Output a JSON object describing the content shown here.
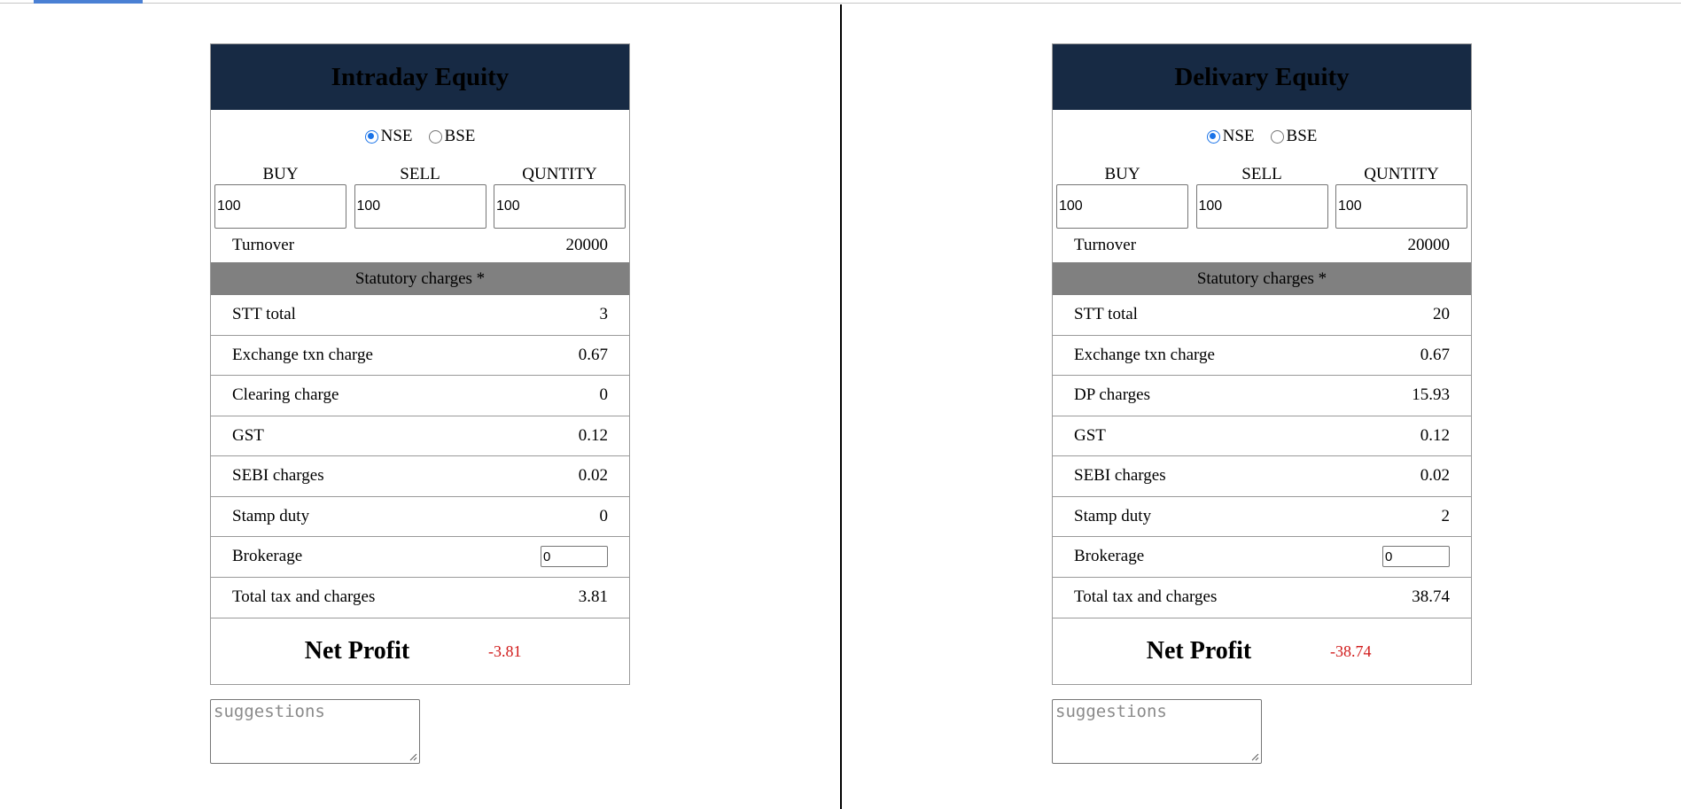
{
  "intraday": {
    "title": "Intraday Equity",
    "exchange": {
      "nse": "NSE",
      "bse": "BSE",
      "selected": "NSE"
    },
    "inputs": {
      "buy_label": "BUY",
      "sell_label": "SELL",
      "quantity_label": "QUNTITY",
      "buy": "100",
      "sell": "100",
      "quantity": "100"
    },
    "turnover": {
      "label": "Turnover",
      "value": "20000"
    },
    "statutory_header": "Statutory charges *",
    "charges": [
      {
        "label": "STT total",
        "value": "3"
      },
      {
        "label": "Exchange txn charge",
        "value": "0.67"
      },
      {
        "label": "Clearing charge",
        "value": "0"
      },
      {
        "label": "GST",
        "value": "0.12"
      },
      {
        "label": "SEBI charges",
        "value": "0.02"
      },
      {
        "label": "Stamp duty",
        "value": "0"
      }
    ],
    "brokerage": {
      "label": "Brokerage",
      "value": "0"
    },
    "total": {
      "label": "Total tax and charges",
      "value": "3.81"
    },
    "net_profit": {
      "label": "Net Profit",
      "value": "-3.81"
    },
    "suggestions_placeholder": "suggestions"
  },
  "delivery": {
    "title": "Delivary Equity",
    "exchange": {
      "nse": "NSE",
      "bse": "BSE",
      "selected": "NSE"
    },
    "inputs": {
      "buy_label": "BUY",
      "sell_label": "SELL",
      "quantity_label": "QUNTITY",
      "buy": "100",
      "sell": "100",
      "quantity": "100"
    },
    "turnover": {
      "label": "Turnover",
      "value": "20000"
    },
    "statutory_header": "Statutory charges *",
    "charges": [
      {
        "label": "STT total",
        "value": "20"
      },
      {
        "label": "Exchange txn charge",
        "value": "0.67"
      },
      {
        "label": "DP charges",
        "value": "15.93"
      },
      {
        "label": "GST",
        "value": "0.12"
      },
      {
        "label": "SEBI charges",
        "value": "0.02"
      },
      {
        "label": "Stamp duty",
        "value": "2"
      }
    ],
    "brokerage": {
      "label": "Brokerage",
      "value": "0"
    },
    "total": {
      "label": "Total tax and charges",
      "value": "38.74"
    },
    "net_profit": {
      "label": "Net Profit",
      "value": "-38.74"
    },
    "suggestions_placeholder": "suggestions"
  },
  "colors": {
    "header_bg": "#172a44",
    "stat_header_bg": "#808080",
    "loss": "#d11a1a",
    "radio_accent": "#1a73e8"
  }
}
